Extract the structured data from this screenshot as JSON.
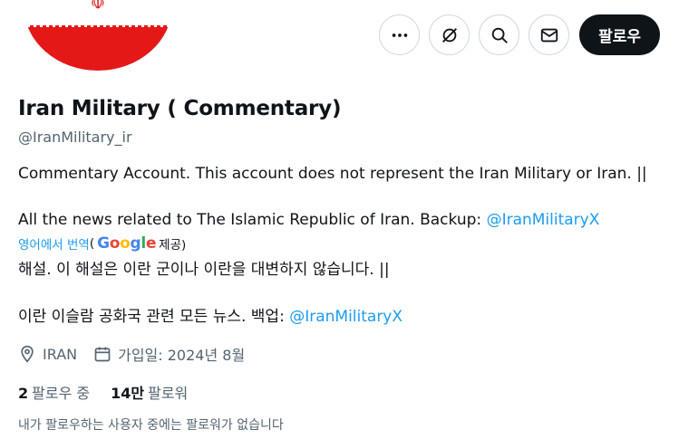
{
  "profile": {
    "name": "Iran Military ( Commentary)",
    "handle": "@IranMilitary_ir",
    "bio_line1": "Commentary Account. This account does not represent the Iran Military or Iran. ||",
    "bio_line2": "All the news related to The Islamic Republic of Iran. Backup:",
    "bio_mention": "@IranMilitaryX"
  },
  "translation": {
    "link": "영어에서 번역",
    "prefix": "(",
    "provider_suffix": "제공)",
    "line1": "해설. 이 해설은 이란 군이나 이란을 대변하지 않습니다. ||",
    "line2": "이란 이슬람 공화국 관련 모든 뉴스. 백업:",
    "mention": "@IranMilitaryX"
  },
  "actions": {
    "more_icon": "more-icon",
    "grok_icon": "grok-icon",
    "search_icon": "search-icon",
    "message_icon": "message-icon",
    "follow_label": "팔로우"
  },
  "meta": {
    "location": "IRAN",
    "joined": "가입일: 2024년 8월"
  },
  "stats": {
    "following_count": "2",
    "following_label": "팔로우 중",
    "followers_count": "14만",
    "followers_label": "팔로워"
  },
  "no_mutual_text": "내가 팔로우하는 사용자 중에는 팔로워가 없습니다",
  "colors": {
    "accent": "#1d9bf0",
    "text": "#0f1419",
    "secondary": "#536471",
    "flag_red": "#e51818"
  }
}
